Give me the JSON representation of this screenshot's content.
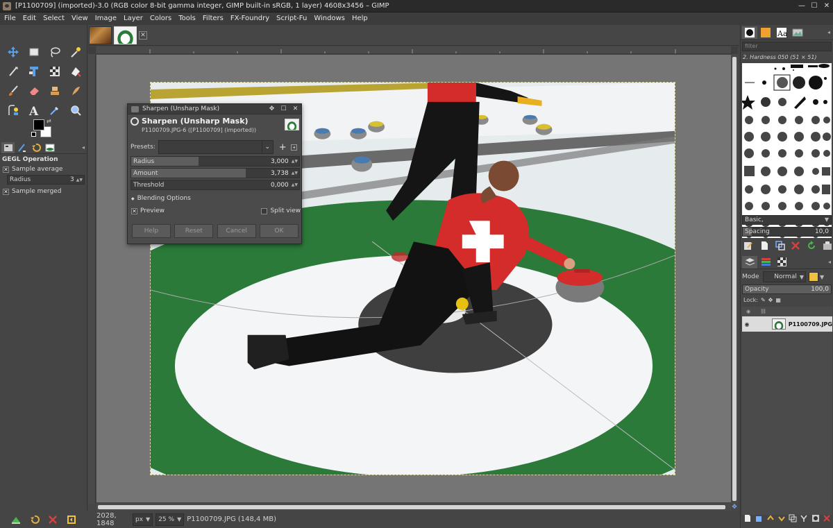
{
  "window": {
    "title": "[P1100709] (imported)-3.0 (RGB color 8-bit gamma integer, GIMP built-in sRGB, 1 layer) 4608x3456 – GIMP",
    "min_glyph": "—",
    "max_glyph": "☐",
    "close_glyph": "✕"
  },
  "menubar": [
    "File",
    "Edit",
    "Select",
    "View",
    "Image",
    "Layer",
    "Colors",
    "Tools",
    "Filters",
    "FX-Foundry",
    "Script-Fu",
    "Windows",
    "Help"
  ],
  "toolbox": {
    "tools": [
      "move-tool-icon",
      "rect-select-icon",
      "lasso-icon",
      "fuzzy-select-icon",
      "crop-icon",
      "align-icon",
      "unified-transform-icon",
      "warp-icon",
      "paintbrush-icon",
      "eraser-icon",
      "clone-icon",
      "smudge-icon",
      "paths-icon",
      "text-icon",
      "color-picker-icon",
      "zoom-icon"
    ],
    "tool_options": {
      "title": "GEGL Operation",
      "sample_average_label": "Sample average",
      "radius_label": "Radius",
      "radius_value": "3",
      "sample_merged_label": "Sample merged",
      "check_mark": "✕"
    }
  },
  "image_window": {
    "close_tab_glyph": "✕",
    "status": {
      "coords": "2028, 1848",
      "unit": "px",
      "zoom": "25 %",
      "file_info": "P1100709.JPG (148,4 MB)"
    }
  },
  "dialog": {
    "title": "Sharpen (Unsharp Mask)",
    "heading": "Sharpen (Unsharp Mask)",
    "subheading": "P1100709.JPG-6 ([P1100709] (imported))",
    "g_glyph": "G",
    "presets_label": "Presets:",
    "presets_value": "",
    "radius_label": "Radius",
    "radius_value": "3,000",
    "radius_fraction": 0.4,
    "amount_label": "Amount",
    "amount_value": "3,738",
    "amount_fraction": 0.68,
    "threshold_label": "Threshold",
    "threshold_value": "0,000",
    "threshold_fraction": 0.0,
    "blending_options_label": "Blending Options",
    "preview_label": "Preview",
    "split_view_label": "Split view",
    "buttons": {
      "help": "Help",
      "reset": "Reset",
      "cancel": "Cancel",
      "ok": "OK"
    }
  },
  "right_dock": {
    "filter_placeholder": "filter",
    "brush_name": "2. Hardness 050 (51 × 51)",
    "tag_combo": "Basic,",
    "spacing_label": "Spacing",
    "spacing_value": "10,0",
    "spacing_fraction": 0.1,
    "mode_label": "Mode",
    "mode_value": "Normal",
    "opacity_label": "Opacity",
    "opacity_value": "100,0",
    "opacity_fraction": 1.0,
    "lock_label": "Lock:",
    "layer_name": "P1100709.JPG"
  },
  "colors": {
    "foreground": "#000000",
    "background": "#ffffff",
    "selection_outline": "#d8d8a0"
  }
}
